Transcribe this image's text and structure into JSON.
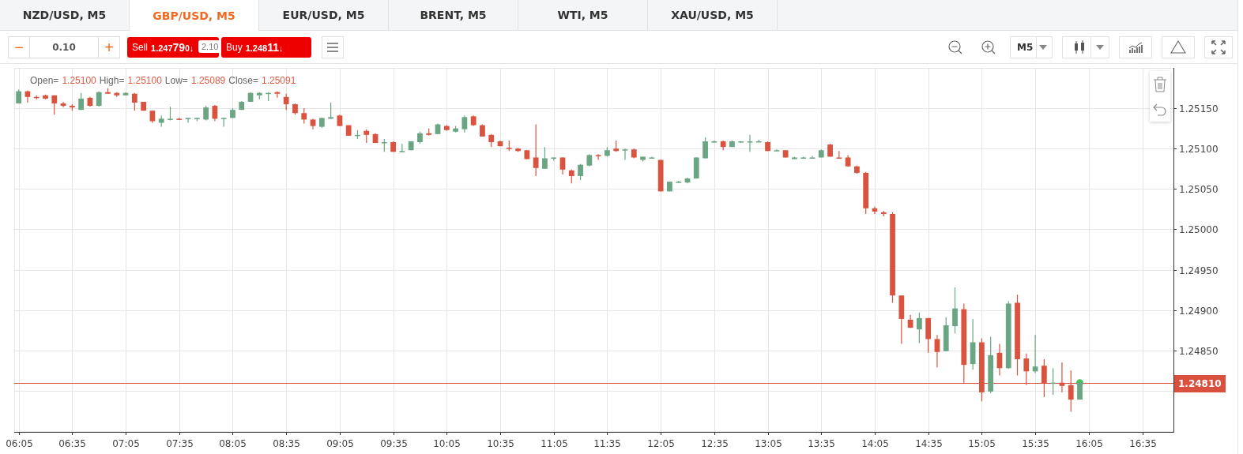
{
  "tabs": [
    {
      "label": "NZD/USD, M5",
      "selected": false
    },
    {
      "label": "GBP/USD, M5",
      "selected": true
    },
    {
      "label": "EUR/USD, M5",
      "selected": false
    },
    {
      "label": "BRENT, M5",
      "selected": false
    },
    {
      "label": "WTI, M5",
      "selected": false
    },
    {
      "label": "XAU/USD, M5",
      "selected": false
    }
  ],
  "toolbar": {
    "lot": {
      "minus": "−",
      "value": "0.10",
      "plus": "+"
    },
    "sell": {
      "label": "Sell",
      "price_head": "1.247",
      "price_big": "79",
      "price_tail": "0",
      "arrow": "↓"
    },
    "spread": "2.10",
    "buy": {
      "label": "Buy",
      "price_head": "1.248",
      "price_big": "11",
      "arrow": "↓"
    },
    "timeframe": "M5"
  },
  "chart": {
    "ohlc_legend": [
      {
        "label": "Open=",
        "value": "1.25100"
      },
      {
        "label": "High=",
        "value": "1.25100"
      },
      {
        "label": "Low=",
        "value": "1.25089"
      },
      {
        "label": "Close=",
        "value": "1.25091"
      }
    ],
    "current_price": "1.24810",
    "chart_data": {
      "type": "candlestick",
      "ylim": [
        1.24749,
        1.252
      ],
      "grid": true,
      "ref_lines": [
        {
          "axis": "y",
          "value": 1.2481
        }
      ],
      "categories": [
        "06:05",
        null,
        null,
        null,
        null,
        null,
        "06:35",
        null,
        null,
        null,
        null,
        null,
        "07:05",
        null,
        null,
        null,
        null,
        null,
        "07:35",
        null,
        null,
        null,
        null,
        null,
        "08:05",
        null,
        null,
        null,
        null,
        null,
        "08:35",
        null,
        null,
        null,
        null,
        null,
        "09:05",
        null,
        null,
        null,
        null,
        null,
        "09:35",
        null,
        null,
        null,
        null,
        null,
        "10:05",
        null,
        null,
        null,
        null,
        null,
        "10:35",
        null,
        null,
        null,
        null,
        null,
        "11:05",
        null,
        null,
        null,
        null,
        null,
        "11:35",
        null,
        null,
        null,
        null,
        null,
        "12:05",
        null,
        null,
        null,
        null,
        null,
        "12:35",
        null,
        null,
        null,
        null,
        null,
        "13:05",
        null,
        null,
        null,
        null,
        null,
        "13:35",
        null,
        null,
        null,
        null,
        null,
        "14:05",
        null,
        null,
        null,
        null,
        null,
        "14:35",
        null,
        null,
        null,
        null,
        null,
        "15:05",
        null,
        null,
        null,
        null,
        null,
        "15:35",
        null,
        null,
        null,
        null,
        null,
        "16:05",
        null,
        null,
        null,
        null,
        null,
        "16:35",
        null,
        null,
        null
      ],
      "yticks": [
        {
          "value": 1.2515,
          "label": "1.25150"
        },
        {
          "value": 1.251,
          "label": "1.25100"
        },
        {
          "value": 1.2505,
          "label": "1.25050"
        },
        {
          "value": 1.25,
          "label": "1.25000"
        },
        {
          "value": 1.2495,
          "label": "1.24950"
        },
        {
          "value": 1.249,
          "label": "1.24900"
        },
        {
          "value": 1.2485,
          "label": "1.24850"
        }
      ],
      "series": [
        {
          "ohlc": [
            [
              1.25156,
              1.25173,
              1.25156,
              1.25171
            ],
            [
              1.25171,
              1.25172,
              1.25157,
              1.25164
            ],
            [
              1.25164,
              1.25166,
              1.25161,
              1.25163
            ],
            [
              1.25166,
              1.25167,
              1.25161,
              1.25162
            ],
            [
              1.25166,
              1.25166,
              1.25142,
              1.25156
            ],
            [
              1.25156,
              1.25158,
              1.25151,
              1.25153
            ],
            [
              1.25153,
              1.25155,
              1.25147,
              1.25151
            ],
            [
              1.25148,
              1.25169,
              1.25148,
              1.25162
            ],
            [
              1.25163,
              1.25164,
              1.25152,
              1.25153
            ],
            [
              1.25153,
              1.25171,
              1.25152,
              1.2517
            ],
            [
              1.2517,
              1.25175,
              1.25168,
              1.25168
            ],
            [
              1.25169,
              1.2517,
              1.25164,
              1.25166
            ],
            [
              1.25166,
              1.2517,
              1.25166,
              1.25169
            ],
            [
              1.25168,
              1.25169,
              1.25147,
              1.25157
            ],
            [
              1.25158,
              1.25158,
              1.25147,
              1.25147
            ],
            [
              1.25147,
              1.25147,
              1.25132,
              1.25134
            ],
            [
              1.25132,
              1.25141,
              1.25127,
              1.25137
            ],
            [
              1.25136,
              1.25152,
              1.25135,
              1.25137
            ],
            [
              1.25137,
              1.25138,
              1.25136,
              1.25136
            ],
            [
              1.25137,
              1.25138,
              1.25132,
              1.25138
            ],
            [
              1.25137,
              1.25138,
              1.25134,
              1.25138
            ],
            [
              1.25136,
              1.25153,
              1.25135,
              1.25151
            ],
            [
              1.25153,
              1.25154,
              1.25134,
              1.25137
            ],
            [
              1.25137,
              1.25138,
              1.25127,
              1.25138
            ],
            [
              1.25138,
              1.2515,
              1.25138,
              1.25148
            ],
            [
              1.25148,
              1.25159,
              1.25148,
              1.25158
            ],
            [
              1.25158,
              1.2517,
              1.25158,
              1.25169
            ],
            [
              1.25166,
              1.2517,
              1.25161,
              1.25169
            ],
            [
              1.25168,
              1.2517,
              1.25159,
              1.25169
            ],
            [
              1.2517,
              1.25171,
              1.25163,
              1.25168
            ],
            [
              1.25164,
              1.25168,
              1.25148,
              1.25155
            ],
            [
              1.25155,
              1.25156,
              1.25142,
              1.25144
            ],
            [
              1.25144,
              1.2515,
              1.25131,
              1.25136
            ],
            [
              1.25136,
              1.25137,
              1.25124,
              1.25128
            ],
            [
              1.25127,
              1.25138,
              1.25126,
              1.25138
            ],
            [
              1.25137,
              1.25157,
              1.25137,
              1.25139
            ],
            [
              1.25141,
              1.25142,
              1.25128,
              1.25128
            ],
            [
              1.25129,
              1.25129,
              1.25116,
              1.25116
            ],
            [
              1.25116,
              1.25123,
              1.25112,
              1.25117
            ],
            [
              1.25122,
              1.25124,
              1.25107,
              1.25117
            ],
            [
              1.25118,
              1.25119,
              1.25107,
              1.25107
            ],
            [
              1.25107,
              1.25112,
              1.25096,
              1.25108
            ],
            [
              1.25108,
              1.25109,
              1.25096,
              1.25096
            ],
            [
              1.25096,
              1.25106,
              1.25096,
              1.25097
            ],
            [
              1.25098,
              1.25109,
              1.25098,
              1.25109
            ],
            [
              1.25108,
              1.25121,
              1.25106,
              1.25119
            ],
            [
              1.25119,
              1.25125,
              1.25116,
              1.25117
            ],
            [
              1.25118,
              1.25131,
              1.25118,
              1.2513
            ],
            [
              1.25128,
              1.25129,
              1.25122,
              1.25123
            ],
            [
              1.25121,
              1.25128,
              1.2512,
              1.25125
            ],
            [
              1.25124,
              1.25141,
              1.2512,
              1.25139
            ],
            [
              1.2514,
              1.25141,
              1.25128,
              1.25129
            ],
            [
              1.25129,
              1.2513,
              1.25115,
              1.25115
            ],
            [
              1.25117,
              1.25118,
              1.25102,
              1.25108
            ],
            [
              1.25109,
              1.2511,
              1.25103,
              1.25103
            ],
            [
              1.25101,
              1.2511,
              1.25097,
              1.251
            ],
            [
              1.251,
              1.25101,
              1.25096,
              1.25097
            ],
            [
              1.25098,
              1.25098,
              1.25087,
              1.25087
            ],
            [
              1.25089,
              1.2513,
              1.25066,
              1.25076
            ],
            [
              1.25075,
              1.25102,
              1.25075,
              1.25088
            ],
            [
              1.25088,
              1.25089,
              1.25085,
              1.25089
            ],
            [
              1.25089,
              1.25089,
              1.25068,
              1.25074
            ],
            [
              1.25073,
              1.25074,
              1.25057,
              1.25066
            ],
            [
              1.25066,
              1.25081,
              1.25061,
              1.2508
            ],
            [
              1.25079,
              1.25093,
              1.25078,
              1.25092
            ],
            [
              1.25092,
              1.25093,
              1.25086,
              1.25091
            ],
            [
              1.25091,
              1.25102,
              1.2509,
              1.25098
            ],
            [
              1.251,
              1.2511,
              1.25096,
              1.25097
            ],
            [
              1.25098,
              1.251,
              1.25086,
              1.25099
            ],
            [
              1.25099,
              1.251,
              1.25088,
              1.25089
            ],
            [
              1.25086,
              1.2509,
              1.25084,
              1.2509
            ],
            [
              1.25088,
              1.2509,
              1.25088,
              1.25089
            ],
            [
              1.25086,
              1.25086,
              1.25047,
              1.25047
            ],
            [
              1.25047,
              1.25059,
              1.25047,
              1.25059
            ],
            [
              1.25058,
              1.2506,
              1.25058,
              1.25059
            ],
            [
              1.25058,
              1.25064,
              1.25057,
              1.25063
            ],
            [
              1.25063,
              1.25089,
              1.25063,
              1.25089
            ],
            [
              1.25088,
              1.25114,
              1.25088,
              1.25109
            ],
            [
              1.25108,
              1.2511,
              1.25107,
              1.25109
            ],
            [
              1.25109,
              1.2511,
              1.25098,
              1.25102
            ],
            [
              1.25102,
              1.2511,
              1.25102,
              1.25109
            ],
            [
              1.25108,
              1.25109,
              1.25107,
              1.25109
            ],
            [
              1.25108,
              1.25117,
              1.25096,
              1.25109
            ],
            [
              1.25108,
              1.25111,
              1.25108,
              1.25109
            ],
            [
              1.25108,
              1.25109,
              1.25097,
              1.25097
            ],
            [
              1.25097,
              1.25099,
              1.25097,
              1.25098
            ],
            [
              1.25098,
              1.25098,
              1.25089,
              1.25089
            ],
            [
              1.25087,
              1.2509,
              1.25087,
              1.25089
            ],
            [
              1.25088,
              1.2509,
              1.25088,
              1.25089
            ],
            [
              1.25088,
              1.25091,
              1.25088,
              1.25089
            ],
            [
              1.25089,
              1.25099,
              1.25089,
              1.25098
            ],
            [
              1.25105,
              1.25106,
              1.2509,
              1.2509
            ],
            [
              1.25089,
              1.25097,
              1.25088,
              1.25088
            ],
            [
              1.25089,
              1.25092,
              1.25078,
              1.25078
            ],
            [
              1.25078,
              1.25079,
              1.25069,
              1.2507
            ],
            [
              1.2507,
              1.25071,
              1.25019,
              1.25026
            ],
            [
              1.25026,
              1.25028,
              1.25019,
              1.25022
            ],
            [
              1.25021,
              1.25023,
              1.25016,
              1.25019
            ],
            [
              1.25019,
              1.25021,
              1.24909,
              1.24918
            ],
            [
              1.24918,
              1.24918,
              1.24858,
              1.24889
            ],
            [
              1.24888,
              1.24894,
              1.24878,
              1.24878
            ],
            [
              1.24876,
              1.24897,
              1.24859,
              1.2489
            ],
            [
              1.2489,
              1.2489,
              1.24847,
              1.24864
            ],
            [
              1.24864,
              1.24869,
              1.24829,
              1.24848
            ],
            [
              1.24849,
              1.24891,
              1.24849,
              1.24881
            ],
            [
              1.2488,
              1.24928,
              1.24871,
              1.24902
            ],
            [
              1.24901,
              1.24908,
              1.24809,
              1.24832
            ],
            [
              1.24833,
              1.24889,
              1.24826,
              1.2486
            ],
            [
              1.2486,
              1.24865,
              1.24787,
              1.24798
            ],
            [
              1.24799,
              1.24867,
              1.24797,
              1.24844
            ],
            [
              1.24847,
              1.24858,
              1.24819,
              1.24828
            ],
            [
              1.24828,
              1.24911,
              1.24827,
              1.24908
            ],
            [
              1.24909,
              1.24919,
              1.24819,
              1.24839
            ],
            [
              1.2484,
              1.24846,
              1.24807,
              1.24824
            ],
            [
              1.24824,
              1.24869,
              1.24822,
              1.2483
            ],
            [
              1.24831,
              1.24839,
              1.24792,
              1.24809
            ],
            [
              1.24809,
              1.24828,
              1.24795,
              1.2481
            ],
            [
              1.2481,
              1.24835,
              1.24798,
              1.24806
            ],
            [
              1.24807,
              1.24825,
              1.24774,
              1.24789
            ],
            [
              1.24789,
              1.2481,
              1.24789,
              1.2481
            ],
            null,
            null,
            null,
            null,
            null,
            null,
            null,
            null,
            null,
            null
          ]
        }
      ]
    }
  }
}
